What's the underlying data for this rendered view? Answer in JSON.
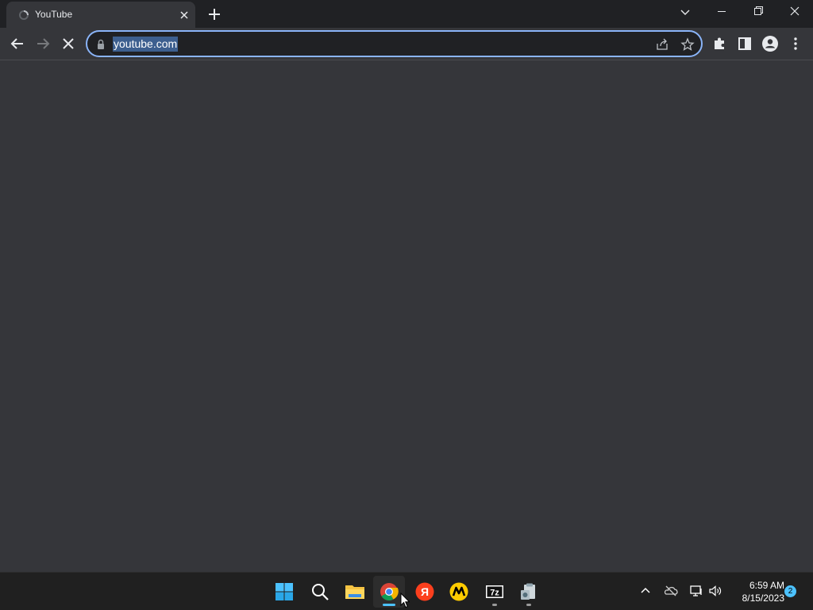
{
  "browser": {
    "tab": {
      "title": "YouTube",
      "favicon": "loading-spinner-icon"
    },
    "address_bar": {
      "url": "youtube.com",
      "selected": true
    },
    "toolbar_icons": [
      "back-icon",
      "forward-icon",
      "stop-icon",
      "lock-icon",
      "share-icon",
      "star-icon",
      "extensions-icon",
      "side-panel-icon",
      "profile-icon",
      "menu-icon"
    ],
    "window_controls": [
      "tab-search-icon",
      "minimize-icon",
      "restore-icon",
      "close-icon"
    ]
  },
  "taskbar": {
    "pinned": [
      {
        "name": "start",
        "icon": "windows-logo-icon"
      },
      {
        "name": "search",
        "icon": "search-icon"
      },
      {
        "name": "file-explorer",
        "icon": "folder-icon"
      },
      {
        "name": "chrome",
        "icon": "chrome-icon",
        "active": true
      },
      {
        "name": "yandex",
        "icon": "yandex-icon"
      },
      {
        "name": "yandex-market",
        "icon": "market-icon"
      },
      {
        "name": "7-zip",
        "icon": "7zip-icon"
      },
      {
        "name": "app",
        "icon": "clipboard-app-icon"
      }
    ],
    "seven_zip_label": "7z",
    "yandex_label": "Я",
    "clock": {
      "time": "6:59 AM",
      "date": "8/15/2023"
    },
    "notification_count": "2"
  },
  "colors": {
    "accent": "#8ab4f8",
    "tab_strip": "#202124",
    "toolbar": "#35363a",
    "taskbar": "#202020",
    "badge": "#4cc2ff"
  }
}
